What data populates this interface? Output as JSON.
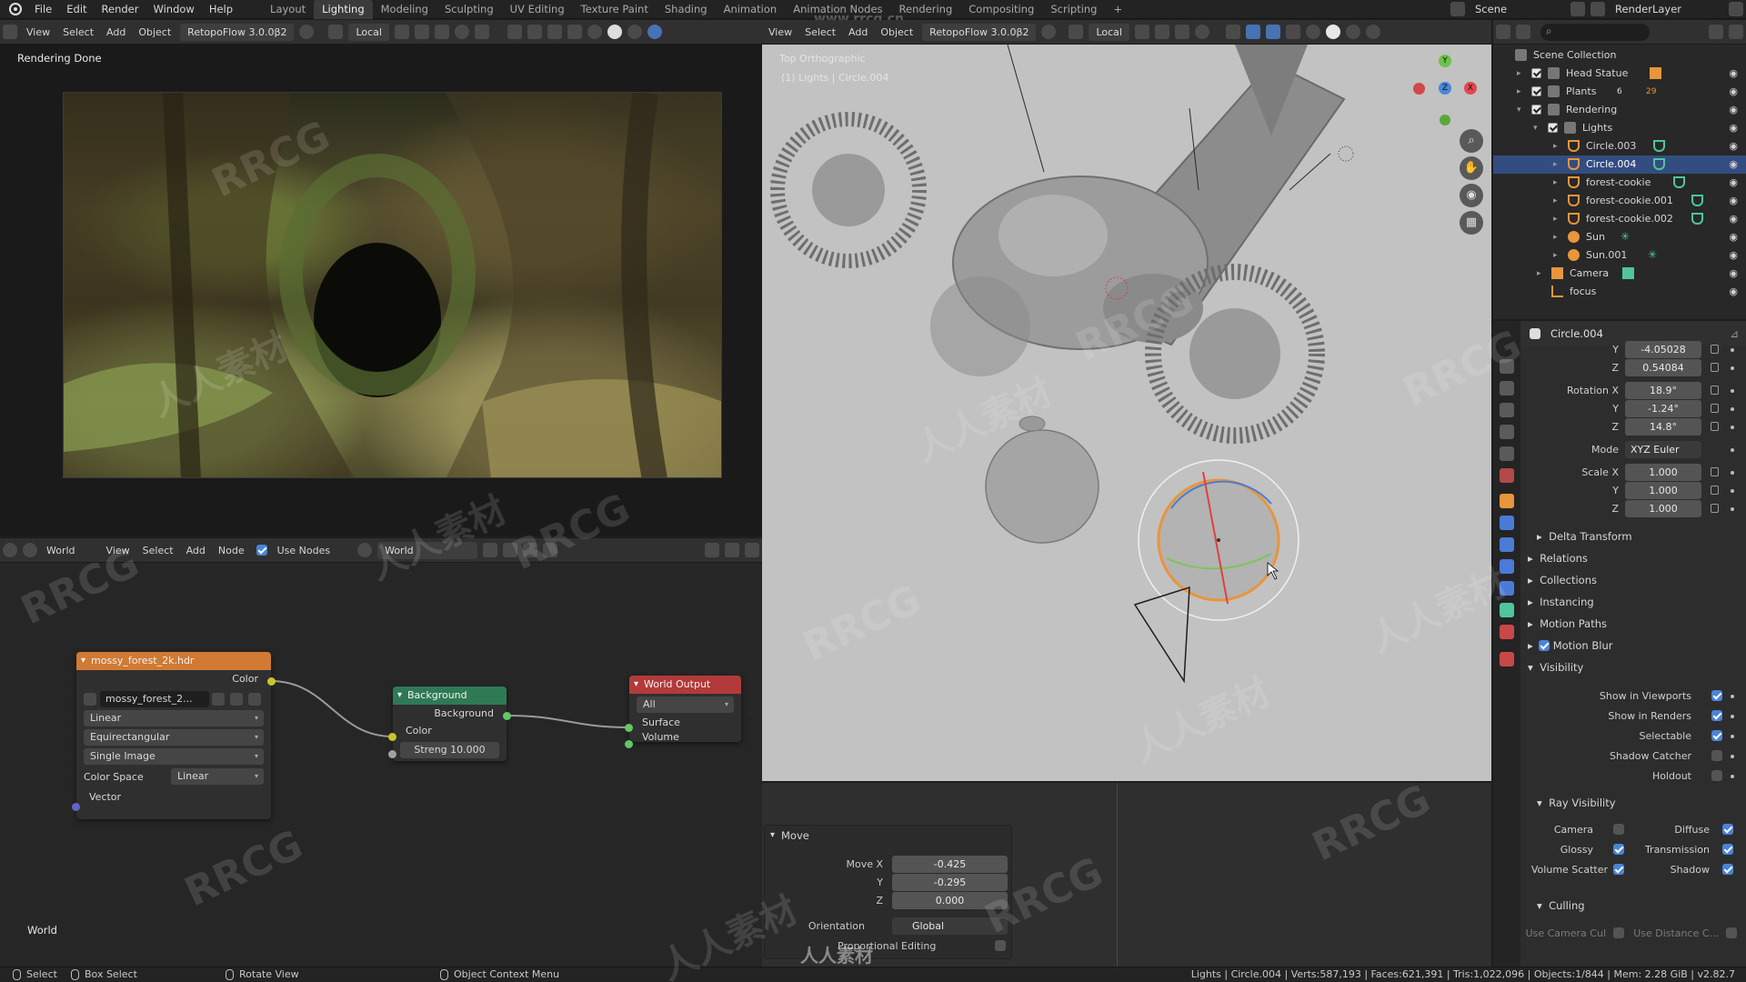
{
  "top_menu": {
    "items": [
      "File",
      "Edit",
      "Render",
      "Window",
      "Help"
    ],
    "workspaces": [
      "Layout",
      "Lighting",
      "Modeling",
      "Sculpting",
      "UV Editing",
      "Texture Paint",
      "Shading",
      "Animation",
      "Animation Nodes",
      "Rendering",
      "Compositing",
      "Scripting"
    ],
    "active_workspace": "Lighting",
    "add_tab": "+",
    "scene_label": "Scene",
    "view_layer_label": "RenderLayer",
    "watermark_url": "www.rrcg.cn"
  },
  "left_header": {
    "view": "View",
    "select": "Select",
    "add": "Add",
    "object": "Object",
    "addon": "RetopoFlow 3.0.0β2",
    "help": "?",
    "orientation": "Local"
  },
  "render_view": {
    "status": "Rendering Done"
  },
  "viewport_header": {
    "view": "View",
    "select": "Select",
    "add": "Add",
    "object": "Object",
    "addon": "RetopoFlow 3.0.0β2",
    "help": "?",
    "orientation": "Local"
  },
  "viewport": {
    "title": "Top Orthographic",
    "subtitle": "(1) Lights | Circle.004",
    "gizmo": {
      "x": "X",
      "y": "Y",
      "z": "Z"
    }
  },
  "operator_panel": {
    "title": "Move",
    "move_x_label": "Move X",
    "move_x": "-0.425",
    "move_y_label": "Y",
    "move_y": "-0.295",
    "move_z_label": "Z",
    "move_z": "0.000",
    "orientation_label": "Orientation",
    "orientation": "Global",
    "proportional_label": "Proportional Editing"
  },
  "node_editor": {
    "header": {
      "type": "World",
      "view": "View",
      "select": "Select",
      "add": "Add",
      "node": "Node",
      "use_nodes": "Use Nodes",
      "world_name": "World"
    },
    "footer_label": "World",
    "image_node": {
      "title": "mossy_forest_2k.hdr",
      "color_out": "Color",
      "image_name": "mossy_forest_2...",
      "interpolation": "Linear",
      "projection": "Equirectangular",
      "source": "Single Image",
      "color_space_label": "Color Space",
      "color_space": "Linear",
      "vector_in": "Vector"
    },
    "background_node": {
      "title": "Background",
      "out": "Background",
      "color_in": "Color",
      "strength_label": "Streng",
      "strength": "10.000"
    },
    "output_node": {
      "title": "World Output",
      "target": "All",
      "surface": "Surface",
      "volume": "Volume"
    }
  },
  "outliner": {
    "root": "Scene Collection",
    "items": [
      {
        "label": "Head Statue",
        "depth": 1
      },
      {
        "label": "Plants",
        "depth": 1
      },
      {
        "label": "Rendering",
        "depth": 1
      },
      {
        "label": "Lights",
        "depth": 2
      },
      {
        "label": "Circle.003",
        "depth": 3
      },
      {
        "label": "Circle.004",
        "depth": 3,
        "selected": true
      },
      {
        "label": "forest-cookie",
        "depth": 3
      },
      {
        "label": "forest-cookie.001",
        "depth": 3
      },
      {
        "label": "forest-cookie.002",
        "depth": 3
      },
      {
        "label": "Sun",
        "depth": 3
      },
      {
        "label": "Sun.001",
        "depth": 3
      },
      {
        "label": "Camera",
        "depth": 2
      },
      {
        "label": "focus",
        "depth": 2
      }
    ],
    "plants_badges": "6",
    "plants_badges_2": "29"
  },
  "properties": {
    "object_name": "Circle.004",
    "location_y_label": "Y",
    "location_y": "-4.05028",
    "location_z_label": "Z",
    "location_z": "0.54084",
    "rotation_x_label": "Rotation X",
    "rotation_x": "18.9°",
    "rotation_y_label": "Y",
    "rotation_y": "-1.24°",
    "rotation_z_label": "Z",
    "rotation_z": "14.8°",
    "mode_label": "Mode",
    "mode": "XYZ Euler",
    "scale_x_label": "Scale X",
    "scale_x": "1.000",
    "scale_y_label": "Y",
    "scale_y": "1.000",
    "scale_z_label": "Z",
    "scale_z": "1.000",
    "sections": [
      "Delta Transform",
      "Relations",
      "Collections",
      "Instancing",
      "Motion Paths",
      "Motion Blur",
      "Visibility"
    ],
    "visibility": {
      "show_in_viewports": "Show in Viewports",
      "show_in_renders": "Show in Renders",
      "selectable": "Selectable",
      "shadow_catcher": "Shadow Catcher",
      "holdout": "Holdout",
      "ray_visibility": "Ray Visibility",
      "camera": "Camera",
      "diffuse": "Diffuse",
      "glossy": "Glossy",
      "transmission": "Transmission",
      "volume_scatter": "Volume Scatter",
      "shadow": "Shadow",
      "culling": "Culling",
      "use_camera_cull": "Use Camera Cul",
      "use_distance_cull": "Use Distance C..."
    }
  },
  "status_bar": {
    "select": "Select",
    "box_select": "Box Select",
    "rotate_view": "Rotate View",
    "context_menu": "Object Context Menu",
    "stats": "Lights | Circle.004 | Verts:587,193 | Faces:621,391 | Tris:1,022,096 | Objects:1/844 | Mem: 2.28 GiB | v2.82.7"
  },
  "colors": {
    "accent": "#4772b3",
    "selection": "#334d80",
    "image_node_header": "#d07a34",
    "background_node_header": "#2e7a55",
    "output_node_header": "#b33a3a",
    "light_orange": "#e8953b"
  },
  "watermarks": [
    "RRCG",
    "人人素材"
  ],
  "brand_footer": "人人素材"
}
